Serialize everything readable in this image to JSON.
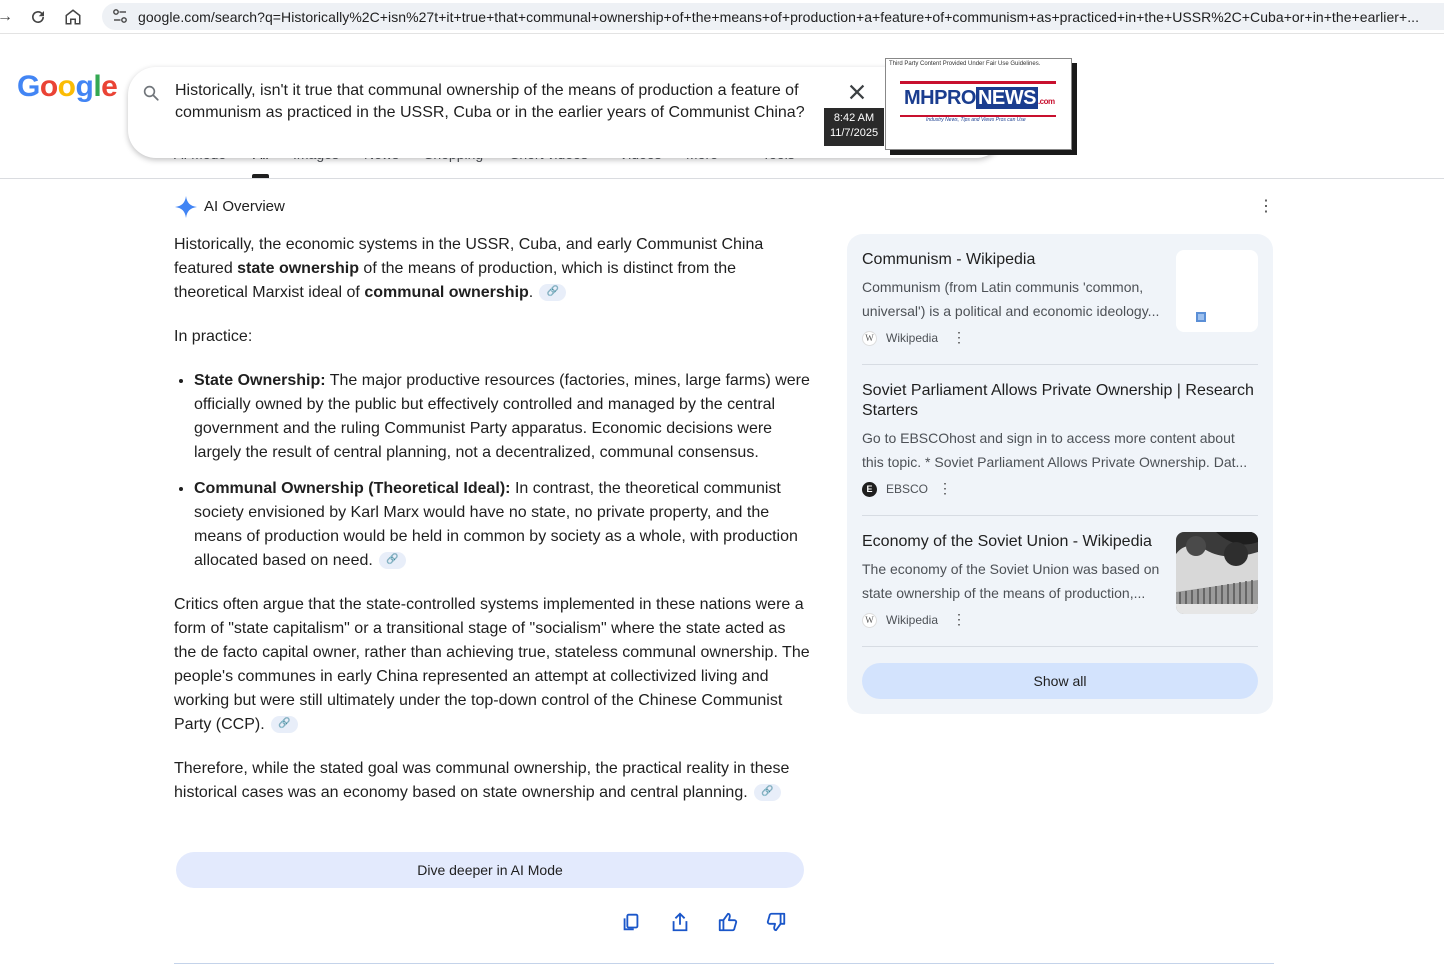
{
  "browser": {
    "url": "google.com/search?q=Historically%2C+isn%27t+it+true+that+communal+ownership+of+the+means+of+production+a+feature+of+communism+as+practiced+in+the+USSR%2C+Cuba+or+in+the+earlier+..."
  },
  "header": {
    "logo": "Google",
    "query": "Historically, isn't it true that communal ownership of the means of production a feature of communism as practiced in the USSR, Cuba or in the earlier years of Communist China?",
    "tabs": [
      {
        "label": "AI Mode"
      },
      {
        "label": "All"
      },
      {
        "label": "Images"
      },
      {
        "label": "News"
      },
      {
        "label": "Shopping"
      },
      {
        "label": "Short videos"
      },
      {
        "label": "Videos"
      },
      {
        "label": "More"
      },
      {
        "label": "Tools"
      }
    ],
    "active_tab": "All"
  },
  "overlay": {
    "time": "8:42 AM",
    "date": "11/7/2025",
    "watermark_caption": "Third Party Content Provided Under Fair Use Guidelines.",
    "watermark_logo_a": "MHPRO",
    "watermark_logo_b": "NEWS",
    "watermark_logo_c": ".com",
    "watermark_tagline": "Industry News, Tips and Views Pros can Use"
  },
  "ai_overview": {
    "title": "AI Overview",
    "p1_a": "Historically, the economic systems in the USSR, Cuba, and early Communist China featured ",
    "p1_b": "state ownership",
    "p1_c": " of the means of production, which is distinct from the theoretical Marxist ideal of ",
    "p1_d": "communal ownership",
    "p1_e": ".",
    "p2": "In practice:",
    "b1_head": "State Ownership:",
    "b1_text": " The major productive resources (factories, mines, large farms) were officially owned by the public but effectively controlled and managed by the central government and the ruling Communist Party apparatus. Economic decisions were largely the result of central planning, not a decentralized, communal consensus.",
    "b2_head": "Communal Ownership (Theoretical Ideal):",
    "b2_text": " In contrast, the theoretical communist society envisioned by Karl Marx would have no state, no private property, and the means of production would be held in common by society as a whole, with production allocated based on need.",
    "p3": "Critics often argue that the state-controlled systems implemented in these nations were a form of \"state capitalism\" or a transitional stage of \"socialism\" where the state acted as the de facto capital owner, rather than achieving true, stateless communal ownership. The people's communes in early China represented an attempt at collectivized living and working but were still ultimately under the top-down control of the Chinese Communist Party (CCP).",
    "p4": "Therefore, while the stated goal was communal ownership, the practical reality in these historical cases was an economy based on state ownership and central planning.",
    "dive_deeper": "Dive deeper in AI Mode"
  },
  "sources": {
    "items": [
      {
        "title": "Communism - Wikipedia",
        "snippet": "Communism (from Latin communis 'common, universal') is a political and economic ideology...",
        "site": "Wikipedia",
        "favicon": "W"
      },
      {
        "title": "Soviet Parliament Allows Private Ownership | Research Starters",
        "snippet": "Go to EBSCOhost and sign in to access more content about this topic. * Soviet Parliament Allows Private Ownership. Dat...",
        "site": "EBSCO",
        "favicon": "E"
      },
      {
        "title": "Economy of the Soviet Union - Wikipedia",
        "snippet": "The economy of the Soviet Union was based on state ownership of the means of production,...",
        "site": "Wikipedia",
        "favicon": "W"
      }
    ],
    "show_all": "Show all"
  },
  "colors": {
    "google_blue": "#4285F4",
    "google_red": "#EA4335",
    "google_yellow": "#FBBC05",
    "google_green": "#34A853",
    "panel_bg": "#f0f4f9",
    "chip_bg": "#d3e3fd"
  }
}
